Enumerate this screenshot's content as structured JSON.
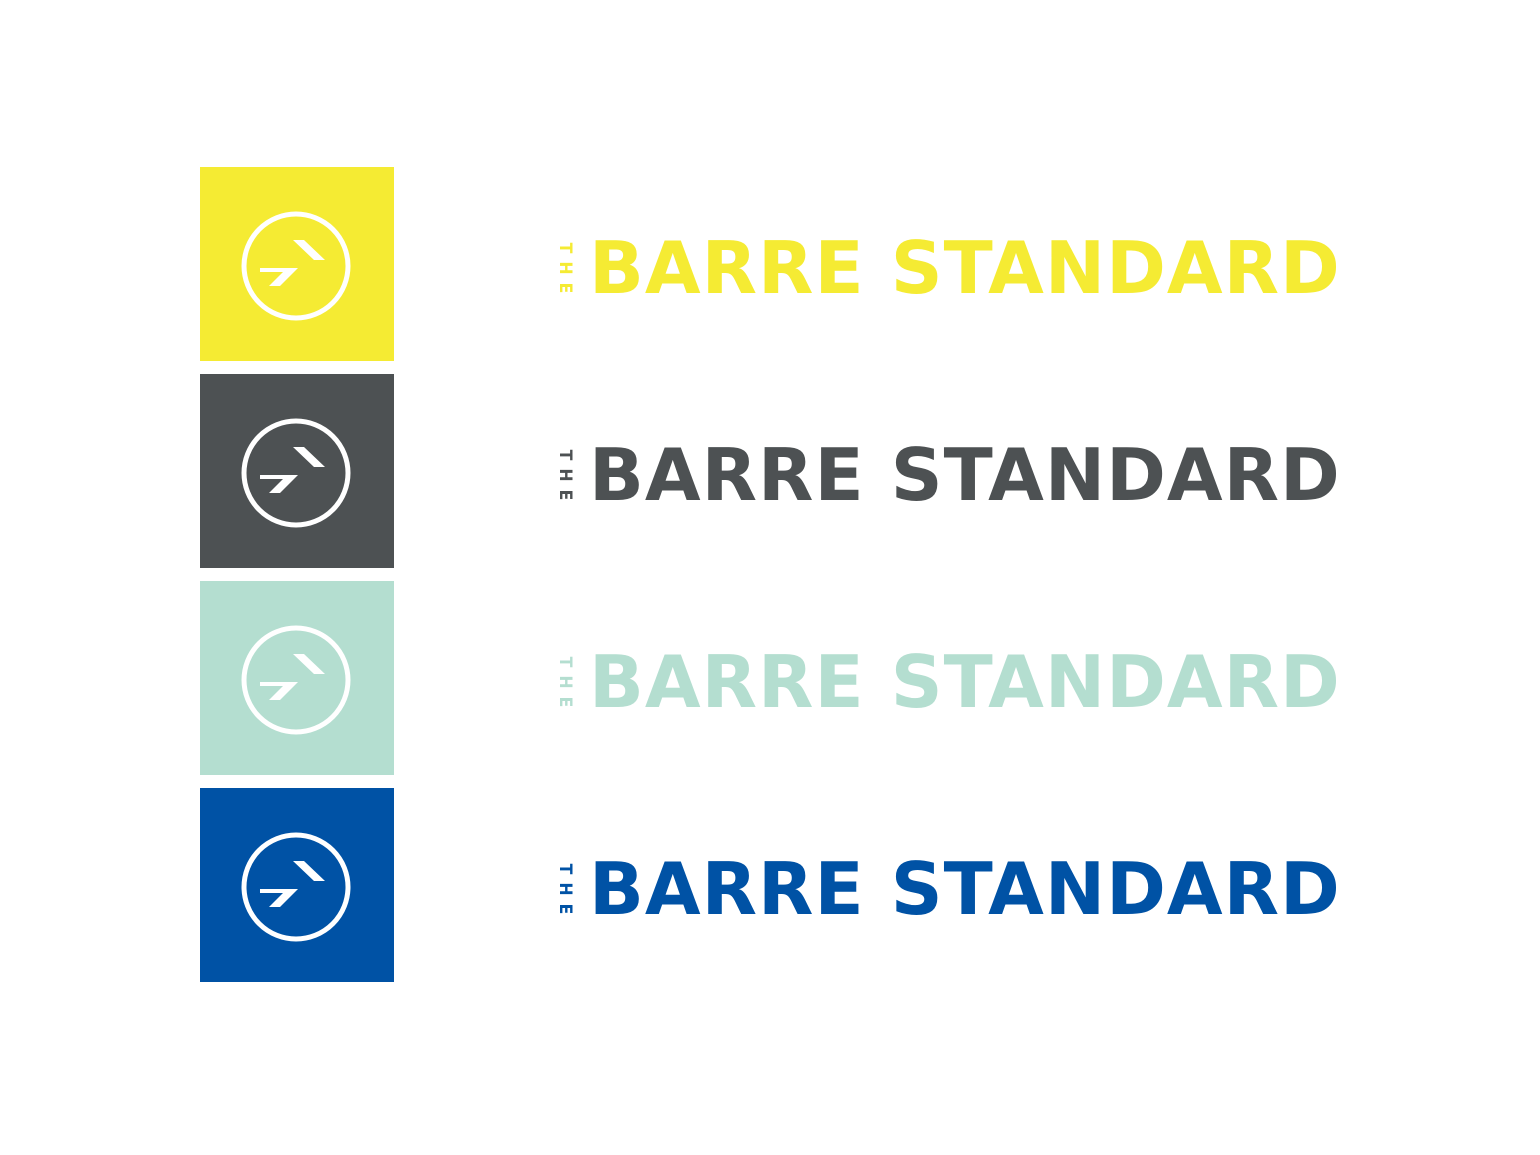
{
  "brand": {
    "the_letters": [
      "T",
      "H",
      "E"
    ],
    "name": "BARRE STANDARD",
    "icon_name": "arrow-circle-icon"
  },
  "variants": [
    {
      "id": "yellow",
      "color": "#f5eb33",
      "icon_color": "#ffffff"
    },
    {
      "id": "charcoal",
      "color": "#4d5153",
      "icon_color": "#ffffff"
    },
    {
      "id": "mint",
      "color": "#b4ded0",
      "icon_color": "#ffffff"
    },
    {
      "id": "blue",
      "color": "#0052a5",
      "icon_color": "#ffffff"
    }
  ]
}
